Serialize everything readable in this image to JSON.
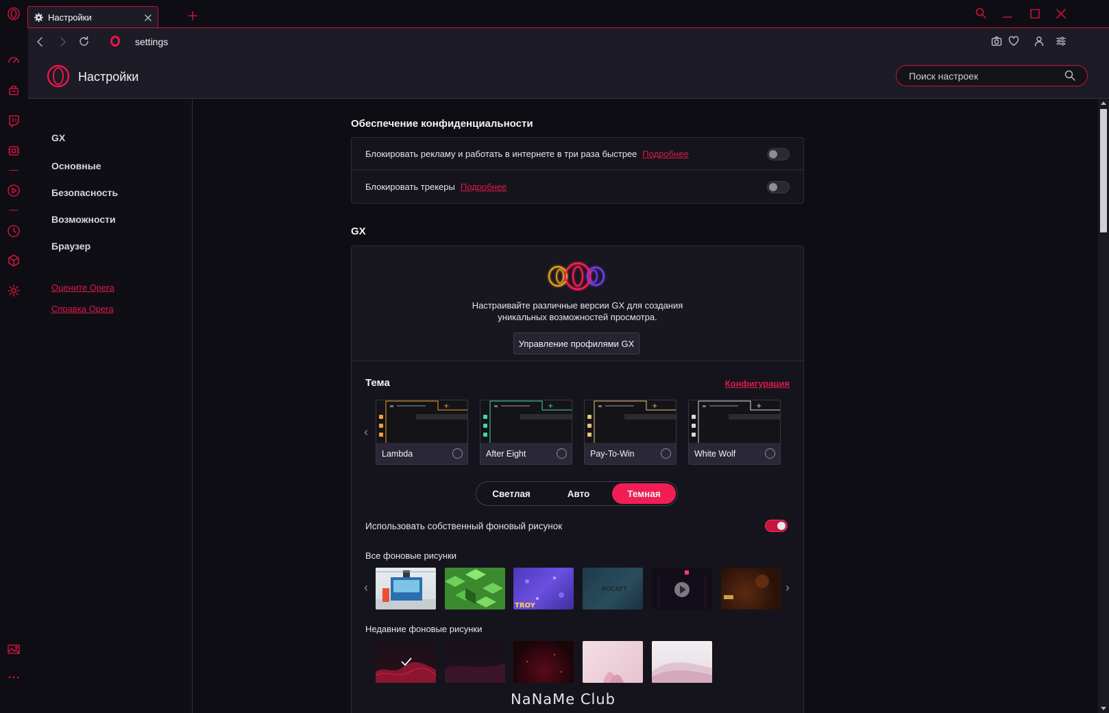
{
  "tab": {
    "title": "Настройки"
  },
  "address": {
    "url": "settings"
  },
  "header": {
    "title": "Настройки",
    "search_placeholder": "Поиск настроек"
  },
  "sidebar": {
    "items": [
      {
        "label": "GX"
      },
      {
        "label": "Основные"
      },
      {
        "label": "Безопасность"
      },
      {
        "label": "Возможности"
      },
      {
        "label": "Браузер"
      }
    ],
    "links": [
      {
        "label": "Оцените Opera"
      },
      {
        "label": "Справка Opera"
      }
    ]
  },
  "privacy": {
    "title": "Обеспечение конфиденциальности",
    "rows": [
      {
        "label": "Блокировать рекламу и работать в интернете в три раза быстрее",
        "link": "Подробнее",
        "enabled": false
      },
      {
        "label": "Блокировать трекеры",
        "link": "Подробнее",
        "enabled": false
      }
    ]
  },
  "gx": {
    "title": "GX",
    "description_line1": "Настраивайте различные версии GX для создания",
    "description_line2": "уникальных возможностей просмотра.",
    "manage_button": "Управление профилями GX",
    "theme_title": "Тема",
    "configure_link": "Конфигурация",
    "themes": [
      {
        "name": "Lambda",
        "accent": "#f0a030"
      },
      {
        "name": "After Eight",
        "accent": "#3fd9a8"
      },
      {
        "name": "Pay-To-Win",
        "accent": "#e8c47a"
      },
      {
        "name": "White Wolf",
        "accent": "#d8d8d8"
      }
    ],
    "mode_options": [
      "Светлая",
      "Авто",
      "Темная"
    ],
    "mode_selected": "Темная",
    "custom_wallpaper_label": "Использовать собственный фоновый рисунок",
    "custom_wallpaper_enabled": true,
    "all_wallpapers_title": "Все фоновые рисунки",
    "recent_wallpapers_title": "Недавние фоновые рисунки"
  },
  "watermark": "NaNaMe Club",
  "colors": {
    "accent": "#c8143c",
    "background": "#0e0d13",
    "panel": "#1d1b26"
  }
}
